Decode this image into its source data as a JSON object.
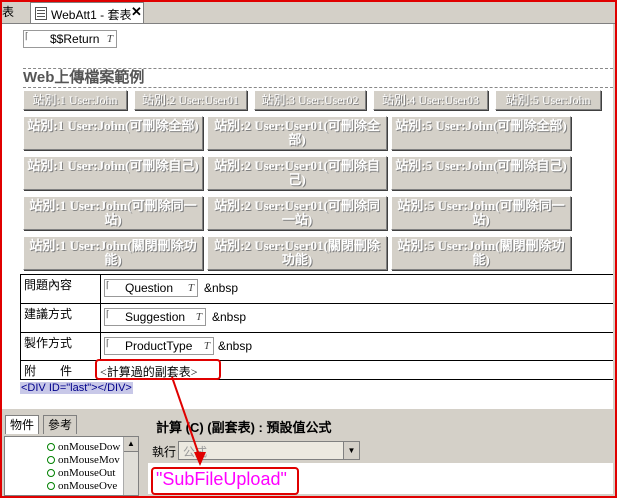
{
  "tabs": {
    "prev_label": "表",
    "active_label": "WebAtt1 - 套表",
    "close_glyph": "✕"
  },
  "canvas": {
    "return_field": {
      "label": "$$Return",
      "type_glyph": "T"
    },
    "heading": "Web上傳檔案範例",
    "row1": [
      "站別:1 User:John",
      "站別:2 User:User01",
      "站別:3 User:User02",
      "站別:4 User:User03",
      "站別:5 User:John"
    ],
    "grid": [
      [
        "站別:1 User:John(可刪除全部)",
        "站別:2 User:User01(可刪除全部)",
        "站別:5 User:John(可刪除全部)"
      ],
      [
        "站別:1 User:John(可刪除自己)",
        "站別:2 User:User01(可刪除自己)",
        "站別:5 User:John(可刪除自己)"
      ],
      [
        "站別:1 User:John(可刪除同一站)",
        "站別:2 User:User01(可刪除同一站)",
        "站別:5 User:John(可刪除同一站)"
      ],
      [
        "站別:1 User:John(關閉刪除功能)",
        "站別:2 User:User01(關閉刪除功能)",
        "站別:5 User:John(關閉刪除功能)"
      ]
    ],
    "table": [
      {
        "label": "問題內容",
        "field": "Question",
        "suffix": "&nbsp"
      },
      {
        "label": "建議方式",
        "field": "Suggestion",
        "suffix": "&nbsp"
      },
      {
        "label": "製作方式",
        "field": "ProductType",
        "suffix": "&nbsp"
      }
    ],
    "attach_label": "附　　件",
    "subform_label": "<計算過的副套表>",
    "div_tag": "<DIV ID=\"last\"></DIV>"
  },
  "left_panel": {
    "tabs": [
      "物件",
      "參考"
    ],
    "events": [
      "onMouseDow",
      "onMouseMov",
      "onMouseOut",
      "onMouseOve"
    ]
  },
  "right_panel": {
    "title": "計算 (C) (副套表) : 預設值公式",
    "run_label": "執行",
    "select_value": "公式",
    "formula": "\"SubFileUpload\""
  },
  "colors": {
    "highlight": "#e00000",
    "formula": "#ff00ff"
  }
}
